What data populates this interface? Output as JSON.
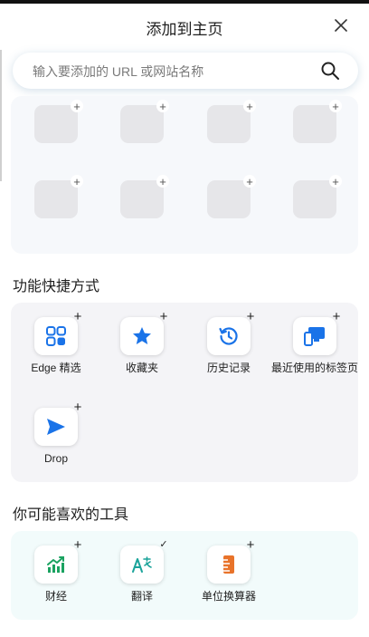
{
  "header": {
    "title": "添加到主页"
  },
  "search": {
    "placeholder": "输入要添加的 URL 或网站名称"
  },
  "sections": {
    "functions_title": "功能快捷方式",
    "tools_title": "你可能喜欢的工具"
  },
  "functions": [
    {
      "label": "Edge 精选",
      "icon": "apps-grid-icon",
      "badge": "+"
    },
    {
      "label": "收藏夹",
      "icon": "star-icon",
      "badge": "+"
    },
    {
      "label": "历史记录",
      "icon": "history-icon",
      "badge": "+"
    },
    {
      "label": "最近使用的标签页",
      "icon": "devices-icon",
      "badge": "+"
    },
    {
      "label": "Drop",
      "icon": "send-icon",
      "badge": "+"
    }
  ],
  "tools": [
    {
      "label": "财经",
      "icon": "finance-chart-icon",
      "badge": "+"
    },
    {
      "label": "翻译",
      "icon": "translate-icon",
      "badge": "✓"
    },
    {
      "label": "单位换算器",
      "icon": "unit-converter-icon",
      "badge": "+"
    }
  ],
  "shortcut_tile_badge": "+",
  "colors": {
    "accent": "#1a73e8",
    "finance": "#1aa260",
    "converter": "#e8732a"
  }
}
